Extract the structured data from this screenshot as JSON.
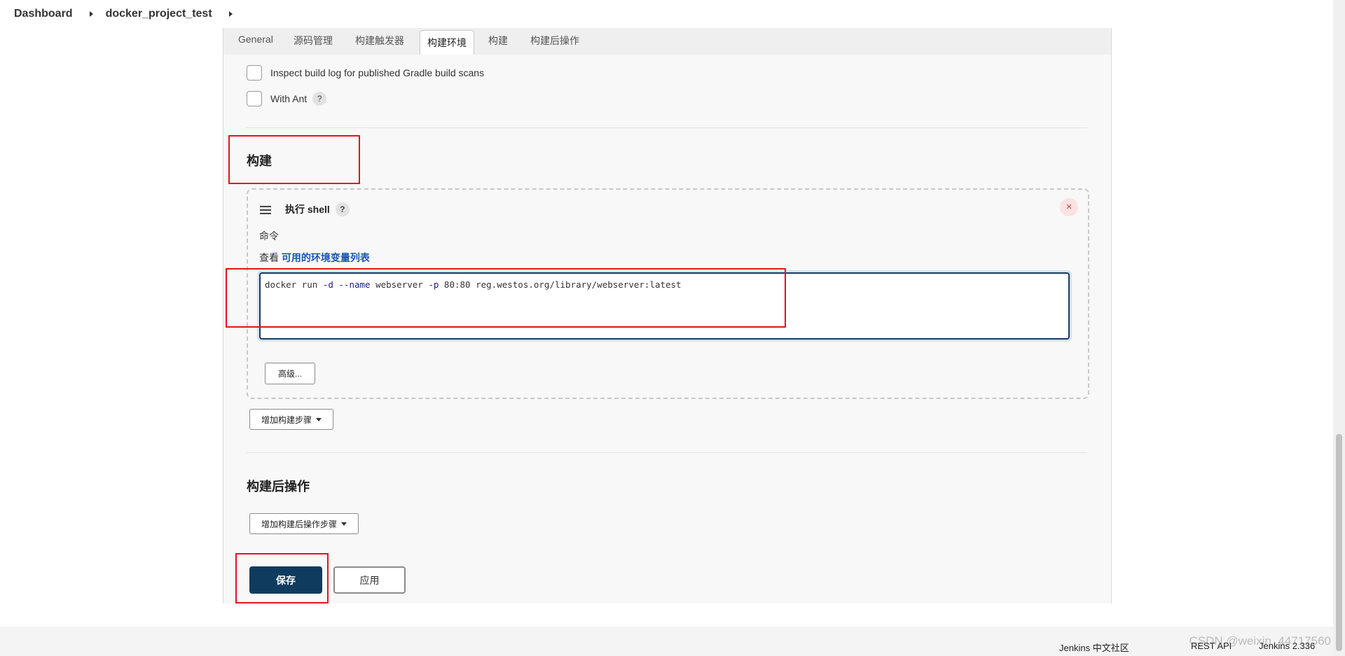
{
  "breadcrumb": {
    "items": [
      "Dashboard",
      "docker_project_test"
    ]
  },
  "tabs": [
    "General",
    "源码管理",
    "构建触发器",
    "构建环境",
    "构建",
    "构建后操作"
  ],
  "env_options": [
    {
      "label": "Inspect build log for published Gradle build scans"
    },
    {
      "label": "With Ant",
      "help": "?"
    }
  ],
  "build": {
    "title": "构建",
    "step": {
      "title": "执行 shell",
      "help": "?",
      "close": "×",
      "command_label": "命令",
      "view_text": "查看",
      "env_link": "可用的环境变量列表",
      "command": {
        "p1": "docker run ",
        "f1": "-d",
        "p2": " ",
        "f2": "--name",
        "p3": " webserver ",
        "f3": "-p",
        "p4": " 80:80 reg.westos.org/library/webserver:latest"
      },
      "advanced_button": "高级..."
    },
    "add_step_button": "增加构建步骤"
  },
  "post_build": {
    "title": "构建后操作",
    "add_button": "增加构建后操作步骤"
  },
  "actions": {
    "save": "保存",
    "apply": "应用"
  },
  "footer": {
    "community": "Jenkins 中文社区",
    "rest_api": "REST API",
    "version": "Jenkins 2.336"
  },
  "watermark": "CSDN @weixin_44717560",
  "colors": {
    "accent": "#0f3c5e",
    "highlight": "#e5121d",
    "link": "#1a55b0"
  }
}
